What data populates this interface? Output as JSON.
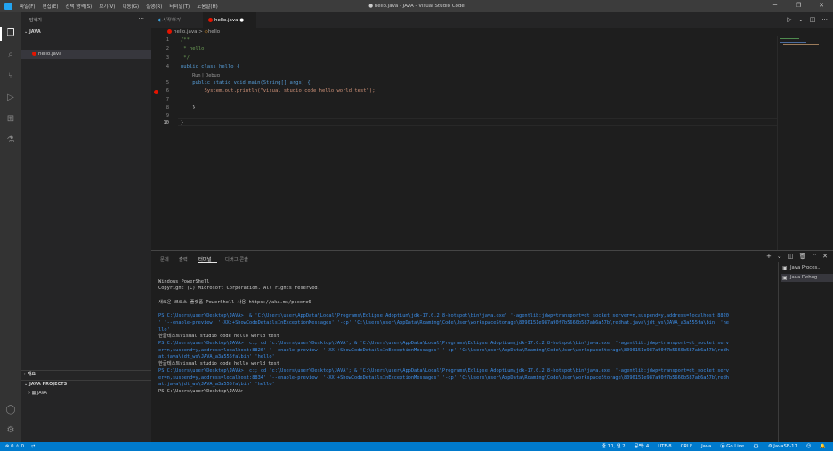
{
  "window": {
    "title": "● hello.java - JAVA - Visual Studio Code"
  },
  "menu": [
    "파일(F)",
    "편집(E)",
    "선택 영역(S)",
    "보기(V)",
    "이동(G)",
    "실행(R)",
    "터미널(T)",
    "도움말(H)"
  ],
  "sidebar": {
    "header": "탐색기",
    "more": "···",
    "folder": "JAVA",
    "file": "hello.java",
    "outline": "개요",
    "java_projects": "JAVA PROJECTS",
    "project": "JAVA"
  },
  "tabs": [
    {
      "label": "시작하기"
    },
    {
      "label": "hello.java",
      "modified_marker": "●"
    }
  ],
  "breadcrumb": {
    "file": "hello.java",
    "sep": ">",
    "symbol": "hello"
  },
  "editor": {
    "lines": [
      {
        "n": "1",
        "text": "/**"
      },
      {
        "n": "2",
        "text": " * hello"
      },
      {
        "n": "3",
        "text": " */"
      },
      {
        "n": "4",
        "text": "public class hello {"
      },
      {
        "n": "5",
        "text": "    public static void main(String[] args) {"
      },
      {
        "n": "6",
        "text": "        System.out.println(\"visual studio code hello world test\");"
      },
      {
        "n": "7",
        "text": ""
      },
      {
        "n": "8",
        "text": "    }"
      },
      {
        "n": "9",
        "text": ""
      },
      {
        "n": "10",
        "text": "}"
      }
    ],
    "codelens": "Run | Debug"
  },
  "panel": {
    "tabs": [
      "문제",
      "출력",
      "터미널",
      "디버그 콘솔"
    ],
    "active_tab": "터미널",
    "terminal_lines": [
      "Windows PowerShell",
      "Copyright (C) Microsoft Corporation. All rights reserved.",
      "",
      "새로운 크로스 플랫폼 PowerShell 사용 https://aka.ms/pscore6",
      "",
      "PS C:\\Users\\user\\Desktop\\JAVA>  & 'C:\\Users\\user\\AppData\\Local\\Programs\\Eclipse Adoptium\\jdk-17.0.2.8-hotspot\\bin\\java.exe' '-agentlib:jdwp=transport=dt_socket,server=n,suspend=y,address=localhost:8820",
      "' '--enable-preview' '-XX:+ShowCodeDetailsInExceptionMessages' '-cp' 'C:\\Users\\user\\AppData\\Roaming\\Code\\User\\workspaceStorage\\8090151e987a90f7b5660b587ab6a57b\\redhat.java\\jdt_ws\\JAVA_a3a555fa\\bin' 'he",
      "llo'",
      "한글테스트visual studio code hello world test",
      "PS C:\\Users\\user\\Desktop\\JAVA>  c:; cd 'c:\\Users\\user\\Desktop\\JAVA'; & 'C:\\Users\\user\\AppData\\Local\\Programs\\Eclipse Adoptium\\jdk-17.0.2.8-hotspot\\bin\\java.exe' '-agentlib:jdwp=transport=dt_socket,serv",
      "er=n,suspend=y,address=localhost:8826' '--enable-preview' '-XX:+ShowCodeDetailsInExceptionMessages' '-cp' 'C:\\Users\\user\\AppData\\Roaming\\Code\\User\\workspaceStorage\\8090151e987a90f7b5660b587ab6a57b\\redh",
      "at.java\\jdt_ws\\JAVA_a3a555fa\\bin' 'hello'",
      "한글테스트visual studio code hello world test",
      "PS C:\\Users\\user\\Desktop\\JAVA>  c:; cd 'c:\\Users\\user\\Desktop\\JAVA'; & 'C:\\Users\\user\\AppData\\Local\\Programs\\Eclipse Adoptium\\jdk-17.0.2.8-hotspot\\bin\\java.exe' '-agentlib:jdwp=transport=dt_socket,serv",
      "er=n,suspend=y,address=localhost:8834' '--enable-preview' '-XX:+ShowCodeDetailsInExceptionMessages' '-cp' 'C:\\Users\\user\\AppData\\Roaming\\Code\\User\\workspaceStorage\\8090151e987a90f7b5660b587ab6a57b\\redh",
      "at.java\\jdt_ws\\JAVA_a3a555fa\\bin' 'hello'",
      "PS C:\\Users\\user\\Desktop\\JAVA>"
    ],
    "terminals": [
      "Java Proces...",
      "Java Debug ..."
    ]
  },
  "status": {
    "problems": "⊗ 0 ⚠ 0",
    "position": "줄 10, 열 2",
    "indent": "공백: 4",
    "encoding": "UTF-8",
    "eol": "CRLF",
    "language": "Java",
    "golive": "Go Live",
    "jdk": "JavaSE-17"
  },
  "colors": {
    "accent": "#007acc",
    "breakpoint": "#e51400"
  }
}
